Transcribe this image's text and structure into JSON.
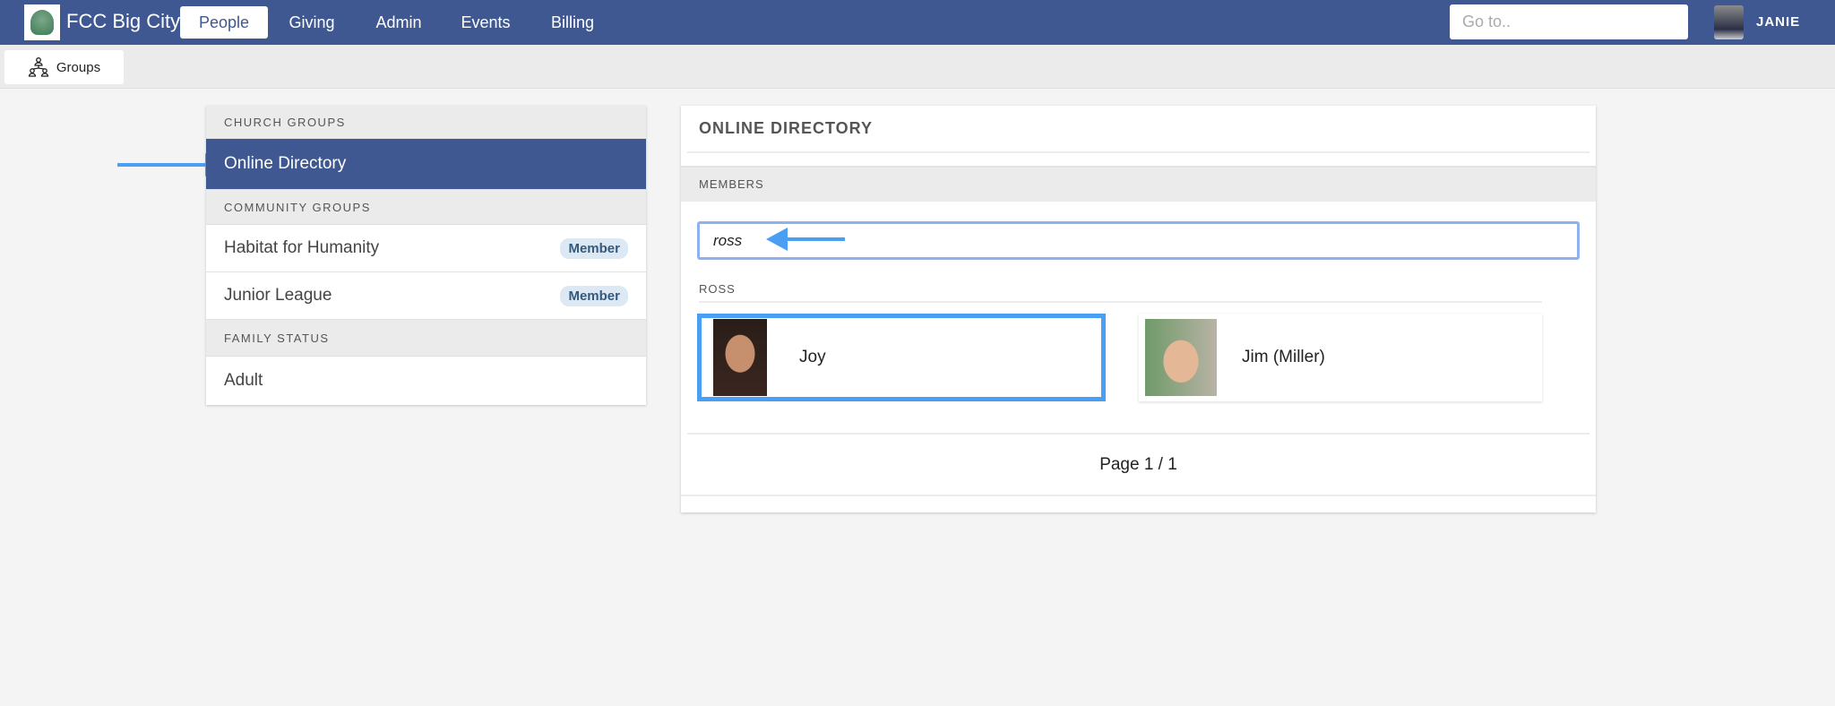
{
  "nav": {
    "brand": "FCC Big City",
    "tabs": [
      "People",
      "Giving",
      "Admin",
      "Events",
      "Billing"
    ],
    "active_tab": "People",
    "goto_placeholder": "Go to..",
    "user": "JANIE"
  },
  "subnav": {
    "groups_label": "Groups"
  },
  "sidebar": {
    "church_groups_header": "CHURCH GROUPS",
    "online_directory": "Online Directory",
    "community_groups_header": "COMMUNITY GROUPS",
    "community_groups": [
      {
        "label": "Habitat for Humanity",
        "badge": "Member"
      },
      {
        "label": "Junior League",
        "badge": "Member"
      }
    ],
    "family_status_header": "FAMILY STATUS",
    "family_status": "Adult"
  },
  "directory": {
    "title": "ONLINE DIRECTORY",
    "members_header": "MEMBERS",
    "search_value": "ross",
    "family_label": "ROSS",
    "people": [
      {
        "name": "Joy"
      },
      {
        "name": "Jim (Miller)"
      }
    ],
    "pagination": "Page 1 / 1"
  },
  "colors": {
    "nav": "#3f5892",
    "highlight": "#4a9ff5"
  }
}
